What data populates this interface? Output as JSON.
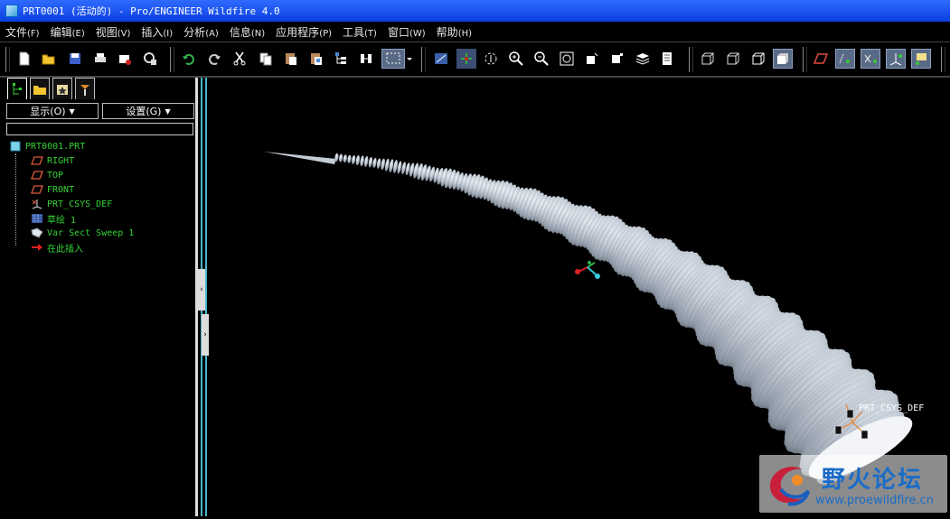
{
  "window": {
    "title": "PRT0001 (活动的) - Pro/ENGINEER Wildfire 4.0"
  },
  "menubar": {
    "items": [
      {
        "label": "文件",
        "key": "(F)"
      },
      {
        "label": "编辑",
        "key": "(E)"
      },
      {
        "label": "视图",
        "key": "(V)"
      },
      {
        "label": "插入",
        "key": "(I)"
      },
      {
        "label": "分析",
        "key": "(A)"
      },
      {
        "label": "信息",
        "key": "(N)"
      },
      {
        "label": "应用程序",
        "key": "(P)"
      },
      {
        "label": "工具",
        "key": "(T)"
      },
      {
        "label": "窗口",
        "key": "(W)"
      },
      {
        "label": "帮助",
        "key": "(H)"
      }
    ]
  },
  "toolbar": {
    "icons": [
      "new-icon",
      "open-icon",
      "save-icon",
      "print-icon",
      "send-mail-icon",
      "regenerate-icon",
      "undo-icon",
      "redo-icon",
      "cut-icon",
      "copy-icon",
      "paste-icon",
      "paste-special-icon",
      "model-tree-toggle-icon",
      "regenerate-model-icon",
      "select-box-icon",
      "repaint-icon",
      "spin-center-icon",
      "orient-icon",
      "zoom-in-icon",
      "zoom-out-icon",
      "refit-icon",
      "reorient-icon",
      "saved-views-icon",
      "layers-icon",
      "view-manager-icon",
      "wireframe-icon",
      "hidden-line-icon",
      "no-hidden-icon",
      "shading-icon",
      "datum-planes-icon",
      "datum-axes-icon",
      "datum-points-icon",
      "csys-icon",
      "annotation-icon"
    ]
  },
  "left_panel": {
    "display_label": "显示(O)",
    "settings_label": "设置(G)",
    "filter_value": "",
    "tree": {
      "root": "PRT0001.PRT",
      "items": [
        {
          "label": "RIGHT",
          "icon": "datum-plane-icon"
        },
        {
          "label": "TOP",
          "icon": "datum-plane-icon"
        },
        {
          "label": "FRONT",
          "icon": "datum-plane-icon"
        },
        {
          "label": "PRT_CSYS_DEF",
          "icon": "csys-icon"
        },
        {
          "label": "草绘 1",
          "icon": "sketch-icon"
        },
        {
          "label": "Var Sect Sweep 1",
          "icon": "sweep-feature-icon"
        },
        {
          "label": "在此插入",
          "icon": "insert-here-arrow-icon"
        }
      ]
    }
  },
  "viewport": {
    "csys_label": "PRT_CSYS_DEF",
    "model_description": "ribbed curved horn variable section sweep"
  },
  "watermark": {
    "title": "野火论坛",
    "url": "www.proewildfire.cn"
  },
  "colors": {
    "title_bar": "#1e56f0",
    "tree_text": "#35d235",
    "model_surface": "#c4ccd6",
    "splitter": "#4ab3c7"
  }
}
